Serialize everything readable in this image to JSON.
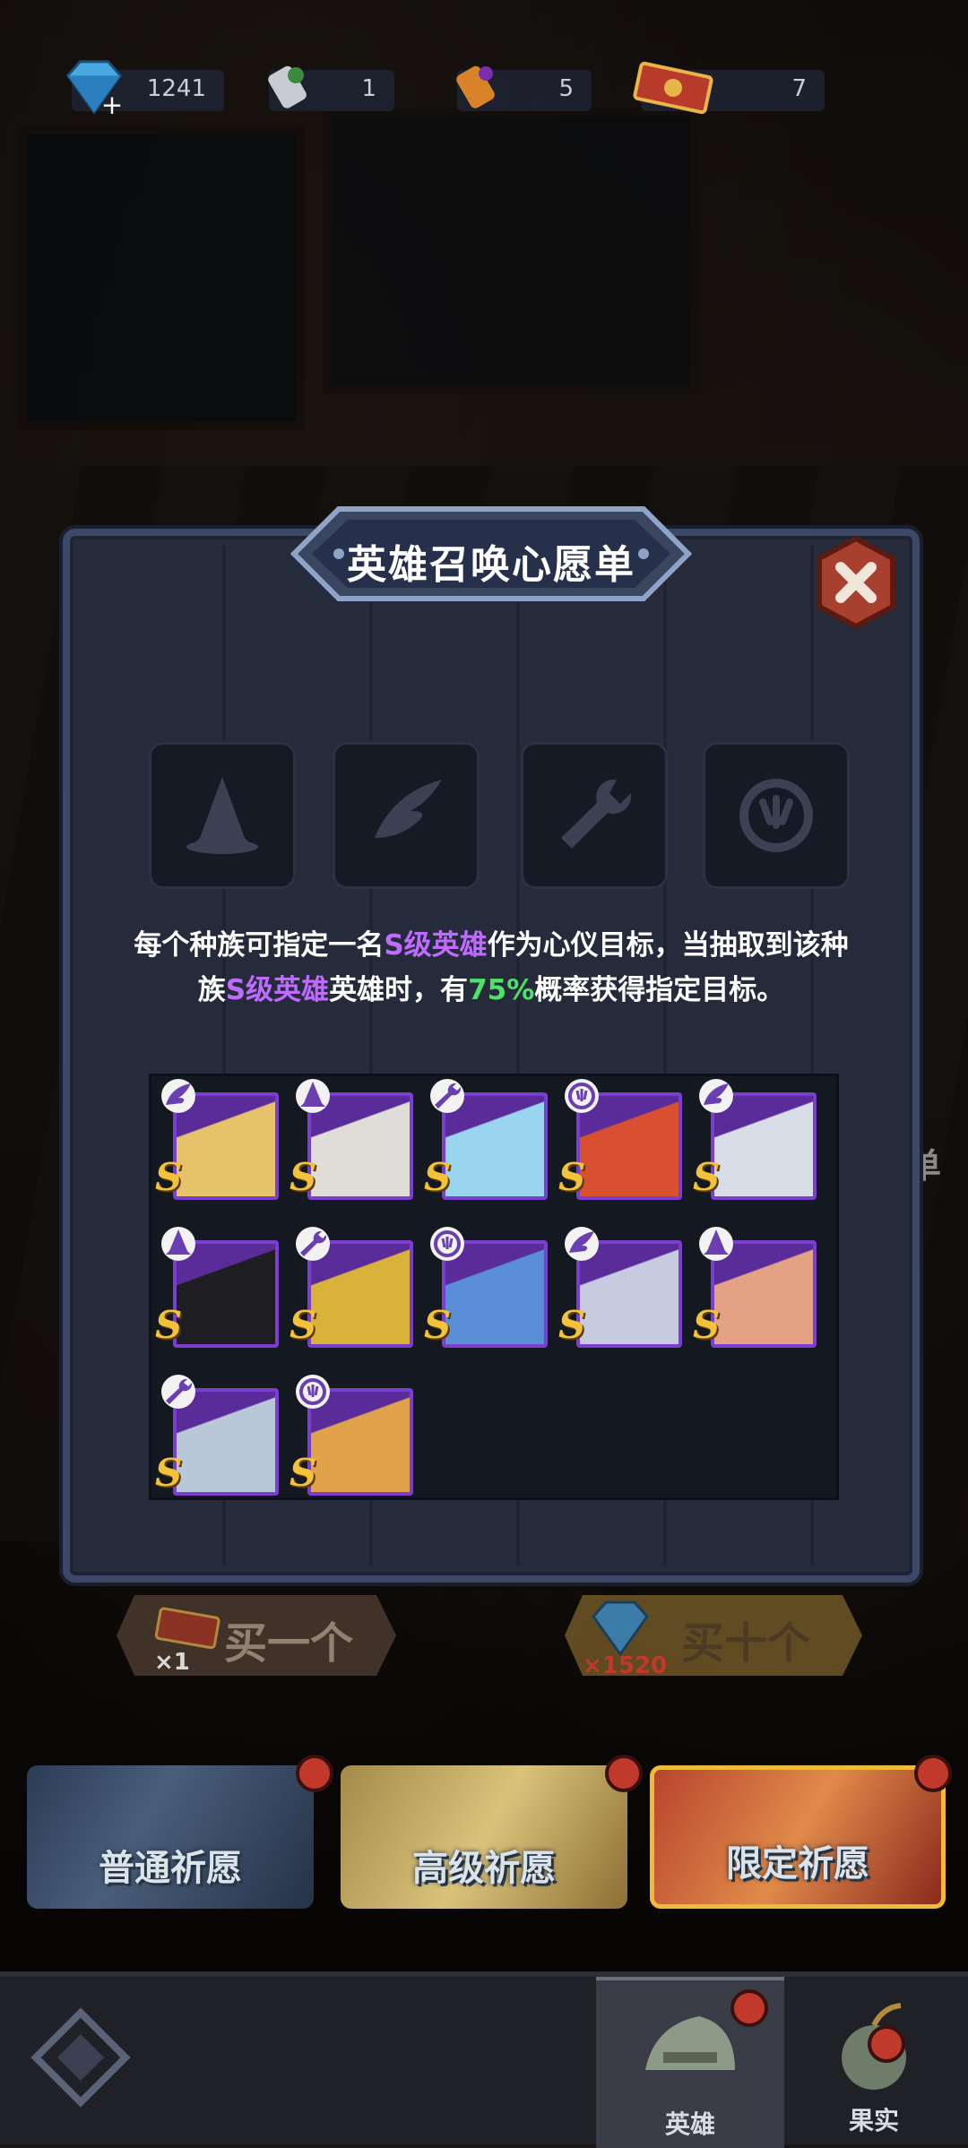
{
  "resources": [
    {
      "icon": "diamond-icon",
      "value": "1241"
    },
    {
      "icon": "scroll-ticket-icon",
      "value": "1"
    },
    {
      "icon": "orange-scroll-icon",
      "value": "5"
    },
    {
      "icon": "red-ticket-icon",
      "value": "7"
    }
  ],
  "modal": {
    "title": "英雄召唤心愿单",
    "description": {
      "p1": "每个种族可指定一名",
      "p2": "S级英雄",
      "p3": "作为心仪目标，当抽取到该种族",
      "p4": "S级英雄",
      "p5": "英雄时，有",
      "p6": "75%",
      "p7": "概率获得指定目标。"
    },
    "race_tabs": [
      "wizard-hat-icon",
      "wing-icon",
      "wrench-icon",
      "beast-claw-icon"
    ],
    "heroes": [
      {
        "race": "wing",
        "rank": "S",
        "color": "#e6c36a"
      },
      {
        "race": "hat",
        "rank": "S",
        "color": "#e0ddd8"
      },
      {
        "race": "wrench",
        "rank": "S",
        "color": "#9ad5f0"
      },
      {
        "race": "claw",
        "rank": "S",
        "color": "#d8502f"
      },
      {
        "race": "wing",
        "rank": "S",
        "color": "#d9dde8"
      },
      {
        "race": "hat",
        "rank": "S",
        "color": "#1e1e22"
      },
      {
        "race": "wrench",
        "rank": "S",
        "color": "#d9b23a"
      },
      {
        "race": "claw",
        "rank": "S",
        "color": "#5a8fd8"
      },
      {
        "race": "wing",
        "rank": "S",
        "color": "#c8cadf"
      },
      {
        "race": "hat",
        "rank": "S",
        "color": "#e2a283"
      },
      {
        "race": "wrench",
        "rank": "S",
        "color": "#b8c8d6"
      },
      {
        "race": "claw",
        "rank": "S",
        "color": "#e0a24a"
      }
    ]
  },
  "buy_one": {
    "label": "买一个",
    "cost": "×1"
  },
  "buy_ten": {
    "label": "买十个",
    "cost": "×1520"
  },
  "banners": [
    "普通祈愿",
    "高级祈愿",
    "限定祈愿"
  ],
  "nav": {
    "hero": "英雄",
    "fruit": "果实"
  },
  "side_text": "单"
}
